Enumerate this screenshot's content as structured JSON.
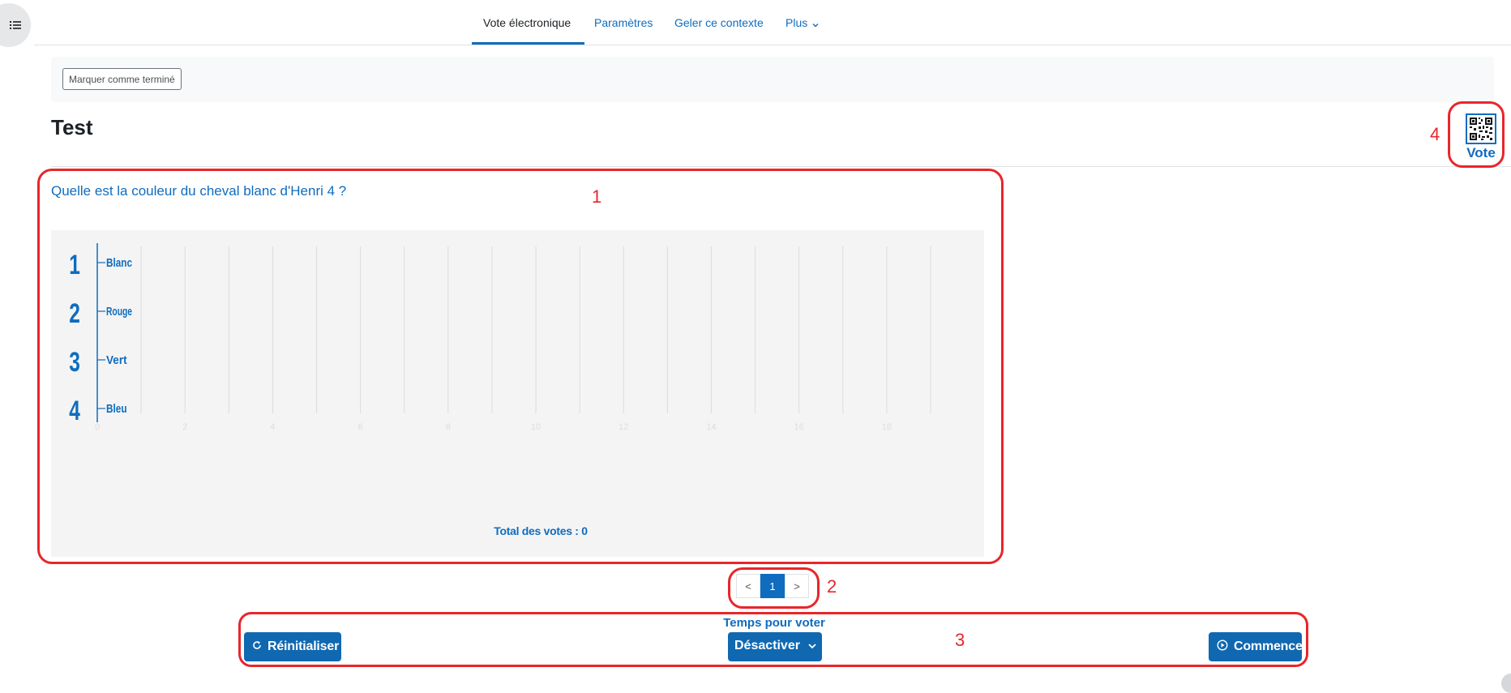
{
  "drawer": {
    "icon": "list-icon"
  },
  "nav": {
    "tabs": [
      {
        "label": "Vote électronique",
        "active": true
      },
      {
        "label": "Paramètres",
        "active": false
      },
      {
        "label": "Geler ce contexte",
        "active": false
      },
      {
        "label": "Plus",
        "active": false,
        "icon": "chevron-down-icon"
      }
    ]
  },
  "completion": {
    "button_label": "Marquer comme terminé"
  },
  "page": {
    "title": "Test"
  },
  "vote_qr": {
    "label": "Vote",
    "icon": "qr-code-icon"
  },
  "question": {
    "text": "Quelle est la couleur du cheval blanc d'Henri 4 ?"
  },
  "chart_data": {
    "type": "bar",
    "orientation": "horizontal",
    "categories": [
      "Blanc",
      "Rouge",
      "Vert",
      "Bleu"
    ],
    "category_numbers": [
      "1",
      "2",
      "3",
      "4"
    ],
    "values": [
      0,
      0,
      0,
      0
    ],
    "xlim": [
      0,
      19
    ],
    "xticks": [
      "0",
      "2",
      "4",
      "6",
      "8",
      "10",
      "12",
      "14",
      "16",
      "18"
    ],
    "grid": true,
    "total_label": "Total des votes : 0"
  },
  "pagination": {
    "prev": "<",
    "current": "1",
    "next": ">"
  },
  "controls": {
    "reset_label": "Réinitialiser",
    "reset_icon": "refresh-icon",
    "time_label": "Temps pour voter",
    "time_select_value": "Désactiver",
    "start_label": "Commencer",
    "start_icon": "play-circle-icon"
  },
  "annotations": [
    "1",
    "2",
    "3",
    "4"
  ],
  "colors": {
    "accent": "#0f6cbf",
    "annotation": "#e8262a",
    "button": "#1068b1"
  }
}
